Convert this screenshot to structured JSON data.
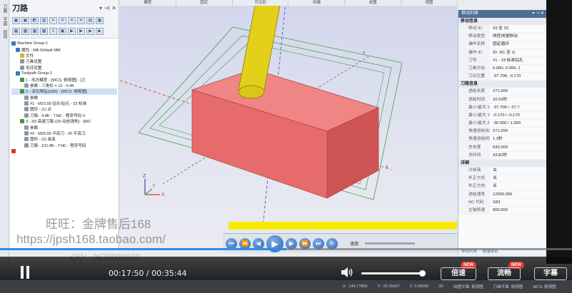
{
  "app": {
    "left_strip_tabs": [
      "刀路",
      "平面",
      "层别"
    ],
    "toolpath_title": "刀路",
    "toolbar_glyphs": [
      "▣",
      "▣",
      "◩",
      "▥",
      "✕",
      "✕",
      "✕",
      "✕",
      "▤",
      "▦",
      "▦",
      "▦",
      "▦",
      "▦",
      "≡",
      "▣",
      "▶",
      "▶",
      "▶",
      "▶"
    ],
    "tree": [
      {
        "label": "Machine Group-1",
        "icon": "blue",
        "indent": 0
      },
      {
        "label": "属性 - Mill Default MM",
        "icon": "blue",
        "indent": 1
      },
      {
        "label": "文件",
        "icon": "yellow",
        "indent": 2
      },
      {
        "label": "刀具设置",
        "icon": "gray",
        "indent": 2
      },
      {
        "label": "毛坯设置",
        "icon": "gray",
        "indent": 2
      },
      {
        "label": "Toolpath Group-1",
        "icon": "blue",
        "indent": 1
      },
      {
        "label": "1 - 毛坯模型 - [WCS: 俯视图] - [刀",
        "icon": "green",
        "indent": 2
      },
      {
        "label": "参数 - 三角形 = 12 - 0.4K",
        "icon": "gray",
        "indent": 3
      },
      {
        "label": "2 - 深孔啄钻(G83) - [WCS: 俯视图]",
        "icon": "green",
        "indent": 2,
        "selected": true
      },
      {
        "label": "参数",
        "icon": "gray",
        "indent": 3
      },
      {
        "label": "#1 - M23.00 钻头/钻孔 - 23 标准",
        "icon": "gray",
        "indent": 3
      },
      {
        "label": "图形 - (1) 点",
        "icon": "gray",
        "indent": 3
      },
      {
        "label": "刀路 - 4.8K - T.NC - 程序号码 0",
        "icon": "gray",
        "indent": 3
      },
      {
        "label": "3 - 2D 高速刀路 (2D 动态铣削) - [WC",
        "icon": "green",
        "indent": 2
      },
      {
        "label": "参数",
        "icon": "gray",
        "indent": 3
      },
      {
        "label": "#2 - M20.00 平底刀 - 20 平底刀",
        "icon": "gray",
        "indent": 3
      },
      {
        "label": "图形 - (2) 串连",
        "icon": "gray",
        "indent": 3
      },
      {
        "label": "刀路 - 101.8K - T.NC - 程序号码",
        "icon": "gray",
        "indent": 3
      },
      {
        "label": "",
        "icon": "red",
        "indent": 0
      }
    ],
    "topbar_tabs": [
      "模型",
      "固定",
      "可见的",
      "传输",
      "放置",
      "视图"
    ],
    "axis_labels": {
      "x": "X",
      "y": "Y",
      "z": "Z",
      "view_x": "X",
      "view_y": "Y",
      "view_z": "Z"
    }
  },
  "move_list": {
    "title": "移动列表",
    "section_move": "移动信息",
    "move_rows": [
      {
        "k": "移动 ID",
        "v": "33 至 33"
      },
      {
        "k": "移动类型",
        "v": "线性快速移动"
      },
      {
        "k": "操作名称",
        "v": "固定循环"
      },
      {
        "k": "操作 ID",
        "v": "ID: 3(1 至 1)"
      },
      {
        "k": "刀号",
        "v": "#1 - 23 标准钻孔"
      },
      {
        "k": "刀具方向",
        "v": "0.000; 0.000; 1"
      },
      {
        "k": "刀尖位置",
        "v": "-37.708; -0.170"
      }
    ],
    "section_path": "刀路信息",
    "path_rows": [
      {
        "k": "进给长度",
        "v": "271.000"
      },
      {
        "k": "进给时间",
        "v": "32.52秒"
      },
      {
        "k": "最小/最大 X",
        "v": "-37.708 / -37.7"
      },
      {
        "k": "最小/最大 Y",
        "v": "-0.170 / -0.170"
      },
      {
        "k": "最小/最大 Z",
        "v": "-30.000 / 1.000"
      },
      {
        "k": "快速进给长度",
        "v": "271.000"
      },
      {
        "k": "快速进给时间",
        "v": "1.3秒"
      },
      {
        "k": "总长度",
        "v": "542.000"
      },
      {
        "k": "总时间",
        "v": "33.82秒"
      }
    ],
    "section_detail": "详细",
    "detail_rows": [
      {
        "k": "冷却液",
        "v": "关"
      },
      {
        "k": "补正方式",
        "v": "关"
      },
      {
        "k": "补正方向",
        "v": "关"
      },
      {
        "k": "进给速率",
        "v": "12500.000"
      },
      {
        "k": "NC 代码",
        "v": "G81"
      },
      {
        "k": "主轴转速",
        "v": "800.000"
      }
    ],
    "footer": [
      "移动列表",
      "碰撞报告"
    ]
  },
  "watermark": {
    "line1": "旺旺：金牌售后168",
    "line2": "https://jpsh168.taobao.com/",
    "line3": "QQ：2678038869"
  },
  "simulator": {
    "speed_label": "速度:"
  },
  "statusbar": [
    "X: -144.77806",
    "Y: -22.35607",
    "Z: 0.00000",
    "3D",
    "绘图平面: 俯视图",
    "刀具平面: 俯视图",
    "WCS: 俯视图"
  ],
  "video": {
    "current_time": "00:17:50",
    "separator": " / ",
    "total_time": "00:35:44",
    "progress": 0.5,
    "volume": 0.94,
    "speed_label": "倍速",
    "fluency_label": "流畅",
    "subtitle_label": "字幕",
    "new_badge": "NEW"
  },
  "colors": {
    "accent": "#2e8de6",
    "block": "#ee6b6b",
    "tool": "#e4d217",
    "highlight_strip": "#f7ea00"
  }
}
